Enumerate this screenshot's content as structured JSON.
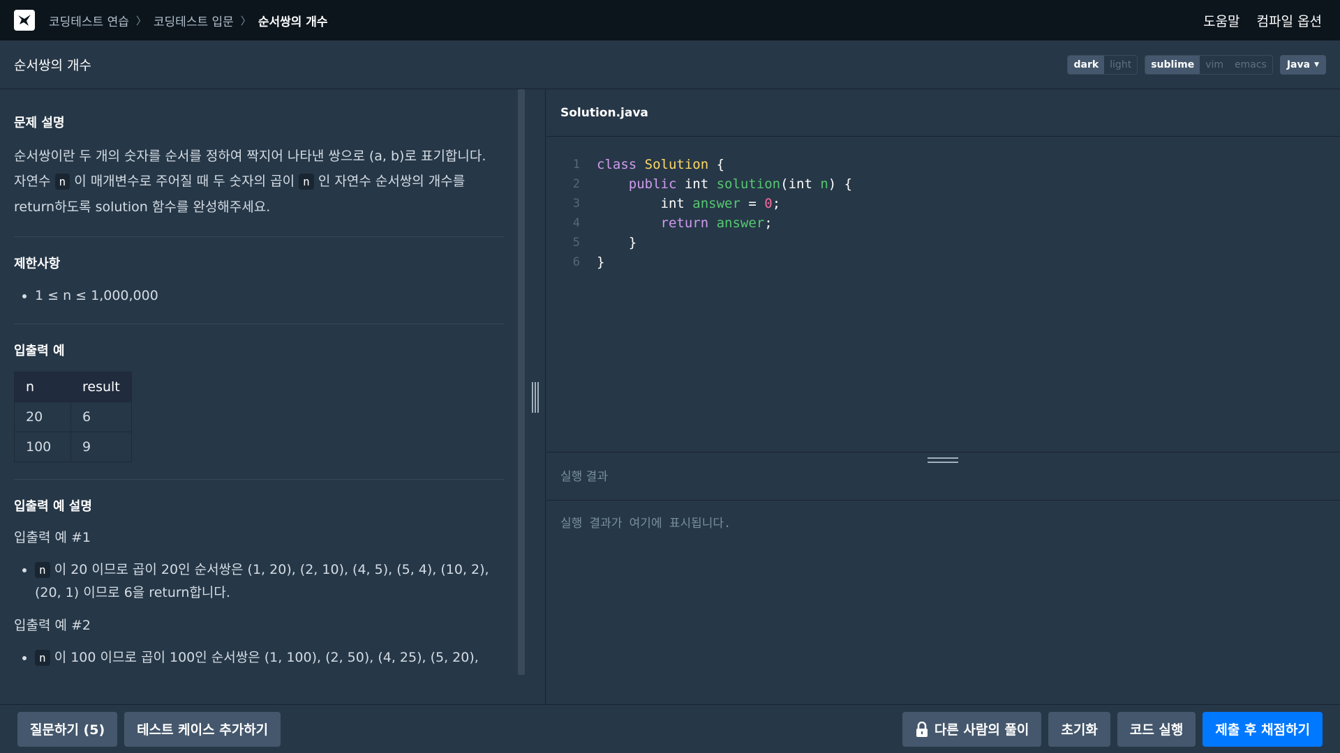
{
  "nav": {
    "breadcrumb": [
      "코딩테스트 연습",
      "코딩테스트 입문",
      "순서쌍의 개수"
    ],
    "help": "도움말",
    "compile_options": "컴파일 옵션"
  },
  "titlebar": {
    "title": "순서쌍의 개수",
    "theme": [
      "dark",
      "light"
    ],
    "theme_selected": "dark",
    "keymap": [
      "sublime",
      "vim",
      "emacs"
    ],
    "keymap_selected": "sublime",
    "language": "Java"
  },
  "problem": {
    "desc_title": "문제 설명",
    "desc_line1": "순서쌍이란 두 개의 숫자를 순서를 정하여 짝지어 나타낸 쌍으로 (a, b)로 표기합니다.",
    "desc_l2_a": "자연수",
    "desc_l2_code1": "n",
    "desc_l2_b": "이 매개변수로 주어질 때 두 숫자의 곱이",
    "desc_l2_code2": "n",
    "desc_l2_c": "인 자연수 순서쌍의 개수를",
    "desc_line3": "return하도록 solution 함수를 완성해주세요.",
    "constraints_title": "제한사항",
    "constraint1": "1 ≤ n ≤ 1,000,000",
    "io_title": "입출력 예",
    "table_headers": [
      "n",
      "result"
    ],
    "table_rows": [
      [
        "20",
        "6"
      ],
      [
        "100",
        "9"
      ]
    ],
    "explain_title": "입출력 예 설명",
    "ex1_title": "입출력 예 #1",
    "ex1_code": "n",
    "ex1_text1": "이 20 이므로 곱이 20인 순서쌍은 (1, 20), (2, 10), (4, 5), (5, 4), (10, 2),",
    "ex1_text2": "(20, 1) 이므로 6을 return합니다.",
    "ex2_title": "입출력 예 #2",
    "ex2_code": "n",
    "ex2_text1": "이 100 이므로 곱이 100인 순서쌍은 (1, 100), (2, 50), (4, 25), (5, 20),"
  },
  "editor": {
    "file": "Solution.java",
    "line_numbers": [
      "1",
      "2",
      "3",
      "4",
      "5",
      "6"
    ],
    "code": {
      "l1_kw": "class",
      "l1_cls": "Solution",
      "l1_rest": " {",
      "l2_kw": "public",
      "l2_type": " int ",
      "l2_fn": "solution",
      "l2_paren": "(int ",
      "l2_param": "n",
      "l2_rest": ") {",
      "l3_type": "int ",
      "l3_var": "answer",
      "l3_eq": " = ",
      "l3_num": "0",
      "l3_semi": ";",
      "l4_kw": "return",
      "l4_var": "answer",
      "l4_semi": ";",
      "l5": "}",
      "l6": "}"
    }
  },
  "result": {
    "title": "실행 결과",
    "placeholder": "실행 결과가 여기에 표시됩니다."
  },
  "bottom": {
    "ask": "질문하기 (5)",
    "add_test": "테스트 케이스 추가하기",
    "others": "다른 사람의 풀이",
    "reset": "초기화",
    "run": "코드 실행",
    "submit": "제출 후 채점하기"
  }
}
